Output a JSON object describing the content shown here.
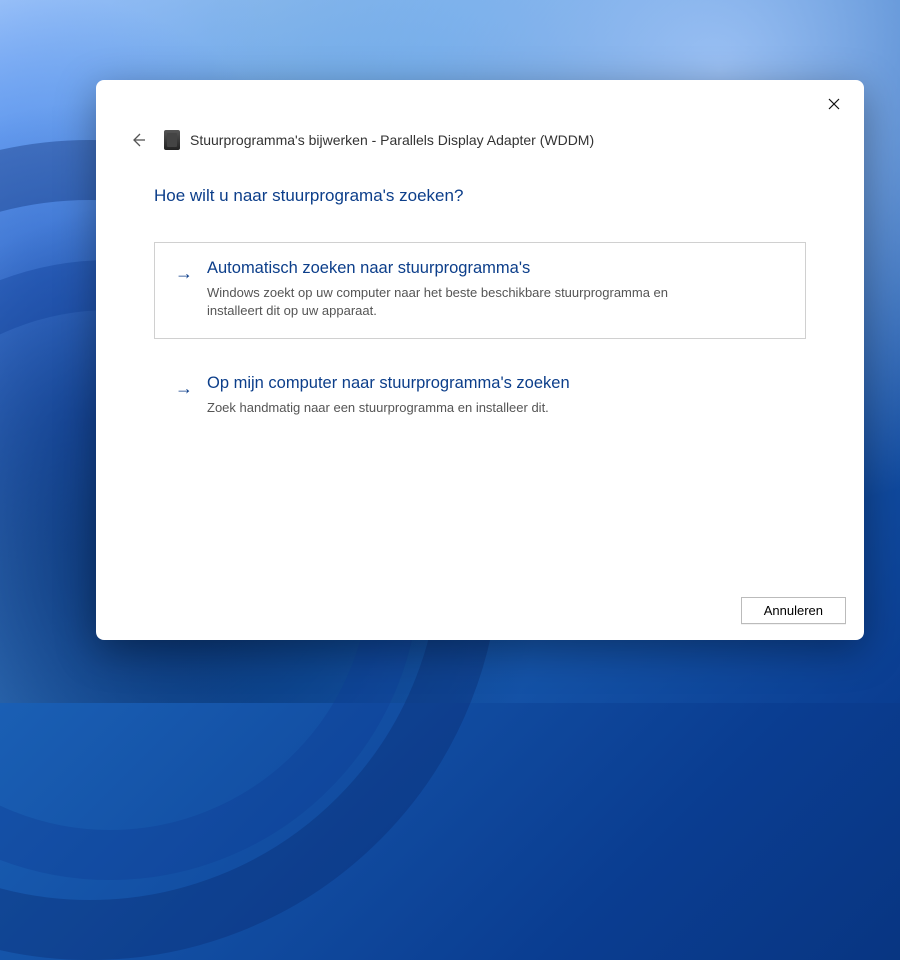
{
  "wizard": {
    "title": "Stuurprogramma's bijwerken - Parallels Display Adapter (WDDM)",
    "question": "Hoe wilt u naar stuurprograma's zoeken?",
    "options": [
      {
        "title": "Automatisch zoeken naar stuurprogramma's",
        "description": "Windows zoekt op uw computer naar het beste beschikbare stuurprogramma en installeert dit op uw apparaat.",
        "selected": true
      },
      {
        "title": "Op mijn computer naar stuurprogramma's zoeken",
        "description": "Zoek handmatig naar een stuurprogramma en installeer dit.",
        "selected": false
      }
    ],
    "buttons": {
      "cancel": "Annuleren"
    }
  }
}
